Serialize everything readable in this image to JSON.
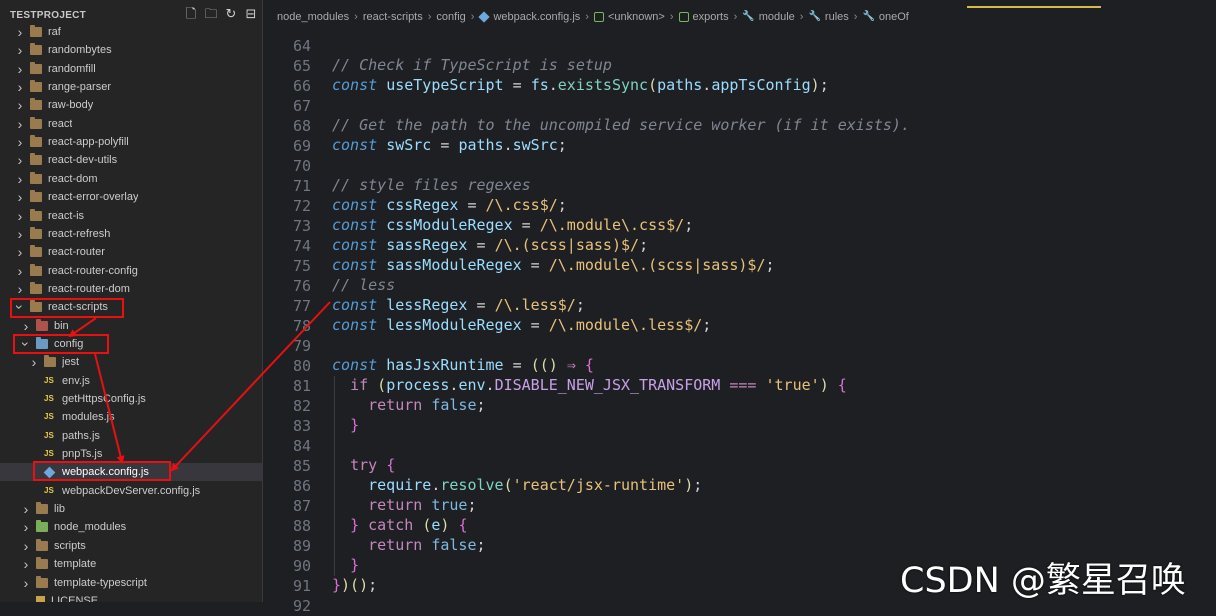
{
  "sidebar": {
    "title": "TESTPROJECT",
    "toolbar": [
      "new-file-icon",
      "new-folder-icon",
      "refresh-icon",
      "collapse-all-icon"
    ],
    "items": [
      {
        "label": "raf",
        "depth": 1,
        "twisty": "collapsed",
        "icon": "folder"
      },
      {
        "label": "randombytes",
        "depth": 1,
        "twisty": "collapsed",
        "icon": "folder"
      },
      {
        "label": "randomfill",
        "depth": 1,
        "twisty": "collapsed",
        "icon": "folder"
      },
      {
        "label": "range-parser",
        "depth": 1,
        "twisty": "collapsed",
        "icon": "folder"
      },
      {
        "label": "raw-body",
        "depth": 1,
        "twisty": "collapsed",
        "icon": "folder"
      },
      {
        "label": "react",
        "depth": 1,
        "twisty": "collapsed",
        "icon": "folder"
      },
      {
        "label": "react-app-polyfill",
        "depth": 1,
        "twisty": "collapsed",
        "icon": "folder"
      },
      {
        "label": "react-dev-utils",
        "depth": 1,
        "twisty": "collapsed",
        "icon": "folder"
      },
      {
        "label": "react-dom",
        "depth": 1,
        "twisty": "collapsed",
        "icon": "folder"
      },
      {
        "label": "react-error-overlay",
        "depth": 1,
        "twisty": "collapsed",
        "icon": "folder"
      },
      {
        "label": "react-is",
        "depth": 1,
        "twisty": "collapsed",
        "icon": "folder"
      },
      {
        "label": "react-refresh",
        "depth": 1,
        "twisty": "collapsed",
        "icon": "folder"
      },
      {
        "label": "react-router",
        "depth": 1,
        "twisty": "collapsed",
        "icon": "folder"
      },
      {
        "label": "react-router-config",
        "depth": 1,
        "twisty": "collapsed",
        "icon": "folder"
      },
      {
        "label": "react-router-dom",
        "depth": 1,
        "twisty": "collapsed",
        "icon": "folder"
      },
      {
        "label": "react-scripts",
        "depth": 1,
        "twisty": "expanded",
        "icon": "folder"
      },
      {
        "label": "bin",
        "depth": 2,
        "twisty": "collapsed",
        "icon": "folder-red"
      },
      {
        "label": "config",
        "depth": 2,
        "twisty": "expanded",
        "icon": "folder-blue"
      },
      {
        "label": "jest",
        "depth": 3,
        "twisty": "collapsed",
        "icon": "folder"
      },
      {
        "label": "env.js",
        "depth": 3,
        "twisty": "none",
        "icon": "js"
      },
      {
        "label": "getHttpsConfig.js",
        "depth": 3,
        "twisty": "none",
        "icon": "js"
      },
      {
        "label": "modules.js",
        "depth": 3,
        "twisty": "none",
        "icon": "js"
      },
      {
        "label": "paths.js",
        "depth": 3,
        "twisty": "none",
        "icon": "js"
      },
      {
        "label": "pnpTs.js",
        "depth": 3,
        "twisty": "none",
        "icon": "js"
      },
      {
        "label": "webpack.config.js",
        "depth": 3,
        "twisty": "none",
        "icon": "webpack",
        "selected": true
      },
      {
        "label": "webpackDevServer.config.js",
        "depth": 3,
        "twisty": "none",
        "icon": "js"
      },
      {
        "label": "lib",
        "depth": 2,
        "twisty": "collapsed",
        "icon": "folder"
      },
      {
        "label": "node_modules",
        "depth": 2,
        "twisty": "collapsed",
        "icon": "folder-green"
      },
      {
        "label": "scripts",
        "depth": 2,
        "twisty": "collapsed",
        "icon": "folder"
      },
      {
        "label": "template",
        "depth": 2,
        "twisty": "collapsed",
        "icon": "folder"
      },
      {
        "label": "template-typescript",
        "depth": 2,
        "twisty": "collapsed",
        "icon": "folder"
      },
      {
        "label": "LICENSE",
        "depth": 2,
        "twisty": "none",
        "icon": "file"
      }
    ]
  },
  "breadcrumb": [
    {
      "label": "node_modules",
      "icon": ""
    },
    {
      "label": "react-scripts",
      "icon": ""
    },
    {
      "label": "config",
      "icon": ""
    },
    {
      "label": "webpack.config.js",
      "icon": "webpack"
    },
    {
      "label": "<unknown>",
      "icon": "cube"
    },
    {
      "label": "exports",
      "icon": "cube"
    },
    {
      "label": "module",
      "icon": "wrench"
    },
    {
      "label": "rules",
      "icon": "wrench"
    },
    {
      "label": "oneOf",
      "icon": "wrench"
    }
  ],
  "editor": {
    "lines": [
      {
        "n": "64",
        "tokens": []
      },
      {
        "n": "65",
        "tokens": [
          [
            "comment",
            "// Check if TypeScript is setup"
          ]
        ]
      },
      {
        "n": "66",
        "tokens": [
          [
            "kw",
            "const"
          ],
          [
            "op",
            " "
          ],
          [
            "var",
            "useTypeScript"
          ],
          [
            "op",
            " = "
          ],
          [
            "var",
            "fs"
          ],
          [
            "op",
            "."
          ],
          [
            "fn",
            "existsSync"
          ],
          [
            "paren",
            "("
          ],
          [
            "var",
            "paths"
          ],
          [
            "op",
            "."
          ],
          [
            "var",
            "appTsConfig"
          ],
          [
            "paren",
            ")"
          ],
          [
            "op",
            ";"
          ]
        ]
      },
      {
        "n": "67",
        "tokens": []
      },
      {
        "n": "68",
        "tokens": [
          [
            "comment",
            "// Get the path to the uncompiled service worker (if it exists)."
          ]
        ]
      },
      {
        "n": "69",
        "tokens": [
          [
            "kw",
            "const"
          ],
          [
            "op",
            " "
          ],
          [
            "var",
            "swSrc"
          ],
          [
            "op",
            " = "
          ],
          [
            "var",
            "paths"
          ],
          [
            "op",
            "."
          ],
          [
            "var",
            "swSrc"
          ],
          [
            "op",
            ";"
          ]
        ]
      },
      {
        "n": "70",
        "tokens": []
      },
      {
        "n": "71",
        "tokens": [
          [
            "comment",
            "// style files regexes"
          ]
        ]
      },
      {
        "n": "72",
        "tokens": [
          [
            "kw",
            "const"
          ],
          [
            "op",
            " "
          ],
          [
            "var",
            "cssRegex"
          ],
          [
            "op",
            " = "
          ],
          [
            "re",
            "/\\.css$/"
          ],
          [
            "op",
            ";"
          ]
        ]
      },
      {
        "n": "73",
        "tokens": [
          [
            "kw",
            "const"
          ],
          [
            "op",
            " "
          ],
          [
            "var",
            "cssModuleRegex"
          ],
          [
            "op",
            " = "
          ],
          [
            "re",
            "/\\.module\\.css$/"
          ],
          [
            "op",
            ";"
          ]
        ]
      },
      {
        "n": "74",
        "tokens": [
          [
            "kw",
            "const"
          ],
          [
            "op",
            " "
          ],
          [
            "var",
            "sassRegex"
          ],
          [
            "op",
            " = "
          ],
          [
            "re",
            "/\\.(scss|sass)$/"
          ],
          [
            "op",
            ";"
          ]
        ]
      },
      {
        "n": "75",
        "tokens": [
          [
            "kw",
            "const"
          ],
          [
            "op",
            " "
          ],
          [
            "var",
            "sassModuleRegex"
          ],
          [
            "op",
            " = "
          ],
          [
            "re",
            "/\\.module\\.(scss|sass)$/"
          ],
          [
            "op",
            ";"
          ]
        ]
      },
      {
        "n": "76",
        "tokens": [
          [
            "comment",
            "// less"
          ]
        ]
      },
      {
        "n": "77",
        "tokens": [
          [
            "kw",
            "const"
          ],
          [
            "op",
            " "
          ],
          [
            "var",
            "lessRegex"
          ],
          [
            "op",
            " = "
          ],
          [
            "re",
            "/\\.less$/"
          ],
          [
            "op",
            ";"
          ]
        ]
      },
      {
        "n": "78",
        "tokens": [
          [
            "kw",
            "const"
          ],
          [
            "op",
            " "
          ],
          [
            "var",
            "lessModuleRegex"
          ],
          [
            "op",
            " = "
          ],
          [
            "re",
            "/\\.module\\.less$/"
          ],
          [
            "op",
            ";"
          ]
        ]
      },
      {
        "n": "79",
        "tokens": []
      },
      {
        "n": "80",
        "tokens": [
          [
            "kw",
            "const"
          ],
          [
            "op",
            " "
          ],
          [
            "var",
            "hasJsxRuntime"
          ],
          [
            "op",
            " = "
          ],
          [
            "paren",
            "(() "
          ],
          [
            "kw2",
            "⇒"
          ],
          [
            "op",
            " "
          ],
          [
            "brace",
            "{"
          ]
        ]
      },
      {
        "n": "81",
        "tokens": [
          [
            "op",
            "  "
          ],
          [
            "kw2",
            "if"
          ],
          [
            "op",
            " "
          ],
          [
            "paren",
            "("
          ],
          [
            "var",
            "process"
          ],
          [
            "op",
            "."
          ],
          [
            "var",
            "env"
          ],
          [
            "op",
            "."
          ],
          [
            "const",
            "DISABLE_NEW_JSX_TRANSFORM"
          ],
          [
            "op",
            " "
          ],
          [
            "kw2",
            "==="
          ],
          [
            "op",
            " "
          ],
          [
            "str",
            "'true'"
          ],
          [
            "paren",
            ")"
          ],
          [
            "op",
            " "
          ],
          [
            "brace",
            "{"
          ]
        ]
      },
      {
        "n": "82",
        "tokens": [
          [
            "op",
            "    "
          ],
          [
            "kw2",
            "return"
          ],
          [
            "op",
            " "
          ],
          [
            "bool",
            "false"
          ],
          [
            "op",
            ";"
          ]
        ]
      },
      {
        "n": "83",
        "tokens": [
          [
            "op",
            "  "
          ],
          [
            "brace",
            "}"
          ]
        ]
      },
      {
        "n": "84",
        "tokens": []
      },
      {
        "n": "85",
        "tokens": [
          [
            "op",
            "  "
          ],
          [
            "kw2",
            "try"
          ],
          [
            "op",
            " "
          ],
          [
            "brace",
            "{"
          ]
        ]
      },
      {
        "n": "86",
        "tokens": [
          [
            "op",
            "    "
          ],
          [
            "var",
            "require"
          ],
          [
            "op",
            "."
          ],
          [
            "fn",
            "resolve"
          ],
          [
            "paren",
            "("
          ],
          [
            "str",
            "'react/jsx-runtime'"
          ],
          [
            "paren",
            ")"
          ],
          [
            "op",
            ";"
          ]
        ]
      },
      {
        "n": "87",
        "tokens": [
          [
            "op",
            "    "
          ],
          [
            "kw2",
            "return"
          ],
          [
            "op",
            " "
          ],
          [
            "bool",
            "true"
          ],
          [
            "op",
            ";"
          ]
        ]
      },
      {
        "n": "88",
        "tokens": [
          [
            "op",
            "  "
          ],
          [
            "brace",
            "}"
          ],
          [
            "op",
            " "
          ],
          [
            "kw2",
            "catch"
          ],
          [
            "op",
            " "
          ],
          [
            "paren",
            "("
          ],
          [
            "var",
            "e"
          ],
          [
            "paren",
            ")"
          ],
          [
            "op",
            " "
          ],
          [
            "brace",
            "{"
          ]
        ]
      },
      {
        "n": "89",
        "tokens": [
          [
            "op",
            "    "
          ],
          [
            "kw2",
            "return"
          ],
          [
            "op",
            " "
          ],
          [
            "bool",
            "false"
          ],
          [
            "op",
            ";"
          ]
        ]
      },
      {
        "n": "90",
        "tokens": [
          [
            "op",
            "  "
          ],
          [
            "brace",
            "}"
          ]
        ]
      },
      {
        "n": "91",
        "tokens": [
          [
            "brace",
            "}"
          ],
          [
            "paren",
            ")()"
          ],
          [
            "op",
            ";"
          ]
        ]
      },
      {
        "n": "92",
        "tokens": []
      }
    ]
  },
  "watermark": "CSDN @繁星召唤",
  "colors": {
    "annotation": "#e81010",
    "accent": "#d7ba4c"
  }
}
